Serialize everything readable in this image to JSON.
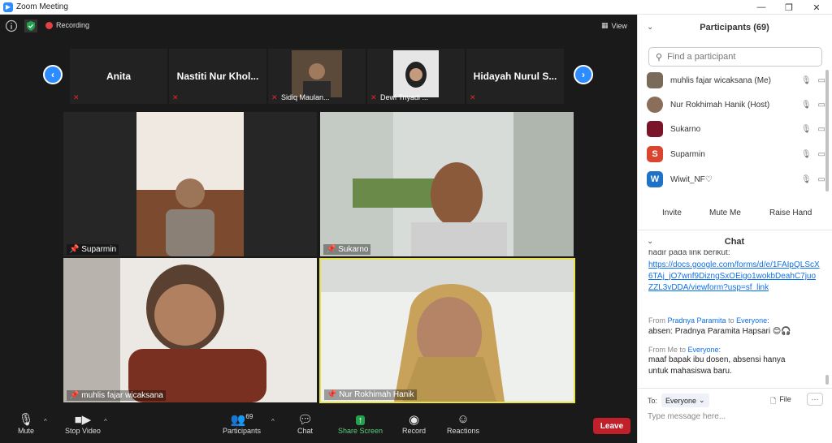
{
  "window": {
    "title": "Zoom Meeting",
    "min": "—",
    "max": "❐",
    "close": "✕"
  },
  "topbar": {
    "recording": "Recording",
    "view": "View"
  },
  "strip": [
    {
      "name": "Anita",
      "label": ""
    },
    {
      "name": "Nastiti Nur Khol...",
      "label": ""
    },
    {
      "name": "",
      "label": "Sidiq Maulan..."
    },
    {
      "name": "",
      "label": "Dewi Triyadi ..."
    },
    {
      "name": "Hidayah Nurul S...",
      "label": ""
    }
  ],
  "tiles": [
    {
      "name": "Suparmin"
    },
    {
      "name": "Sukarno"
    },
    {
      "name": "muhlis fajar wicaksana"
    },
    {
      "name": "Nur Rokhimah Hanik"
    }
  ],
  "toolbar": {
    "mute": "Mute",
    "video": "Stop Video",
    "participants": "Participants",
    "participants_count": "69",
    "chat": "Chat",
    "share": "Share Screen",
    "record": "Record",
    "reactions": "Reactions",
    "leave": "Leave"
  },
  "panel": {
    "participants_title": "Participants (69)",
    "search_placeholder": "Find a participant",
    "participants": [
      {
        "name": "muhlis fajar wicaksana (Me)",
        "initial": "",
        "color": "#7a6a5a"
      },
      {
        "name": "Nur Rokhimah Hanik (Host)",
        "initial": "",
        "color": "#8a6e5a"
      },
      {
        "name": "Sukarno",
        "initial": "",
        "color": "#7a1428"
      },
      {
        "name": "Suparmin",
        "initial": "S",
        "color": "#d9452f"
      },
      {
        "name": "Wiwit_NF♡",
        "initial": "W",
        "color": "#1e73c8"
      }
    ],
    "invite": "Invite",
    "mute_me": "Mute Me",
    "raise_hand": "Raise Hand",
    "chat_title": "Chat",
    "chat_cut": "hadir pada link berikut:",
    "chat_link": "https://docs.google.com/forms/d/e/1FAIpQLScX6TAj_jO7wnf9DizngSxOEigo1wokbDeahC7juoZZL3vDDA/viewform?usp=sf_link",
    "m1_from": "From",
    "m1_sender": "Pradnya Paramita",
    "m1_to": "to",
    "m1_target": "Everyone:",
    "m1_text": "absen: Pradnya Paramita Hapsari 😊🎧",
    "m2_from": "From Me to",
    "m2_target": "Everyone:",
    "m2_text": "maaf bapak ibu dosen, absensi hanya untuk mahasiswa baru.",
    "to_label": "To:",
    "to_value": "Everyone",
    "file": "File",
    "more": "···",
    "input_placeholder": "Type message here..."
  }
}
